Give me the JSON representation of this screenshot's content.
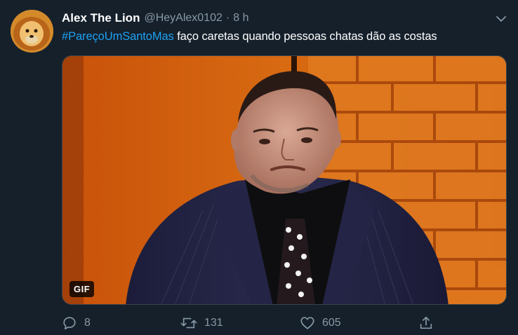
{
  "tweet": {
    "display_name": "Alex The Lion",
    "handle": "@HeyAlex0102",
    "separator": "·",
    "time": "8 h",
    "hashtag": "#PareçoUmSantoMas",
    "text": " faço caretas quando pessoas chatas dão as costas",
    "media_badge": "GIF"
  },
  "actions": {
    "replies": "8",
    "retweets": "131",
    "likes": "605"
  },
  "colors": {
    "background": "#15202b",
    "accent": "#1da1f2",
    "secondary_text": "#8899a6"
  },
  "icons": [
    "chevron-down-icon",
    "reply-icon",
    "retweet-icon",
    "like-icon",
    "share-icon"
  ]
}
